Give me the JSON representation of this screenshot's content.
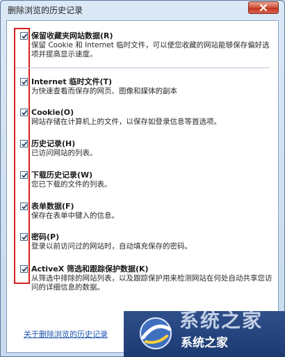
{
  "window": {
    "title": "删除浏览的历史记录"
  },
  "options": [
    {
      "title": "保留收藏夹网站数据(R)",
      "desc": "保留 Cookie 和 Internet 临时文件，可以使您收藏的网站能够保存偏好选项并提高显示速度。",
      "checked": true
    },
    {
      "title": "Internet 临时文件(T)",
      "desc": "为快速查看而保存的网页、图像和媒体的副本",
      "checked": true
    },
    {
      "title": "Cookie(O)",
      "desc": "网站存储在计算机上的文件，以保存如登录信息等首选项。",
      "checked": true
    },
    {
      "title": "历史记录(H)",
      "desc": "已访问网站的列表。",
      "checked": true
    },
    {
      "title": "下载历史记录(W)",
      "desc": "您已下载的文件的列表。",
      "checked": true
    },
    {
      "title": "表单数据(F)",
      "desc": "保存在表单中键入的信息。",
      "checked": true
    },
    {
      "title": "密码(P)",
      "desc": "登录以前访问过的网站时，自动填充保存的密码。",
      "checked": true
    },
    {
      "title": "ActiveX 筛选和跟踪保护数据(K)",
      "desc": "从筛选中排除的网站列表，以及跟踪保护用来检测网站在何处自动共享您访问的详细信息的数据。",
      "checked": true
    }
  ],
  "footer": {
    "link": "关于删除浏览的历史记录"
  },
  "watermark": {
    "big_text": "系统之家",
    "text": "系统之家"
  },
  "colors": {
    "highlight_box": "#d6201c",
    "link": "#1e54b0",
    "close_button": "#c0341d"
  }
}
